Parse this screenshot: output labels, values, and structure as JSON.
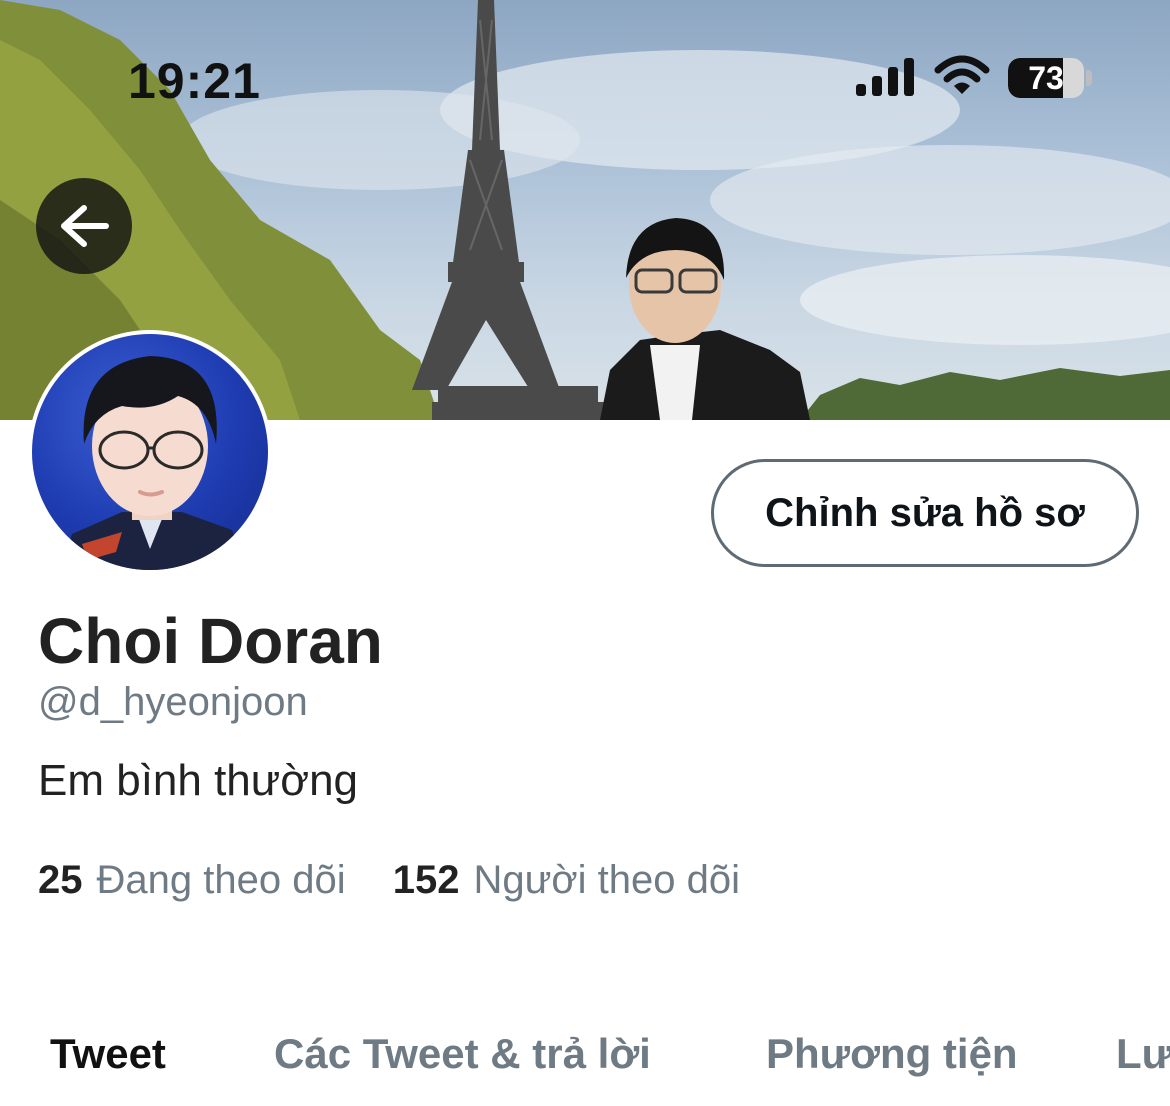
{
  "status_bar": {
    "time": "19:21",
    "battery_level": "73",
    "battery_fraction": 0.73,
    "icons": [
      "signal-icon",
      "wifi-icon",
      "battery-icon"
    ]
  },
  "header": {
    "back_icon": "arrow-left-icon"
  },
  "profile": {
    "edit_button_label": "Chỉnh sửa hồ sơ",
    "display_name": "Choi Doran",
    "handle": "@d_hyeonjoon",
    "bio": "Em bình thường",
    "following_count": "25",
    "following_label": "Đang theo dõi",
    "followers_count": "152",
    "followers_label": "Người theo dõi"
  },
  "tabs": [
    {
      "label": "Tweet",
      "active": true
    },
    {
      "label": "Các Tweet & trả lời",
      "active": false
    },
    {
      "label": "Phương tiện",
      "active": false
    },
    {
      "label": "Lượt thích",
      "active": false
    }
  ],
  "colors": {
    "text_primary": "#222222",
    "text_secondary": "#6e7a84",
    "button_border": "#5f6b74"
  }
}
